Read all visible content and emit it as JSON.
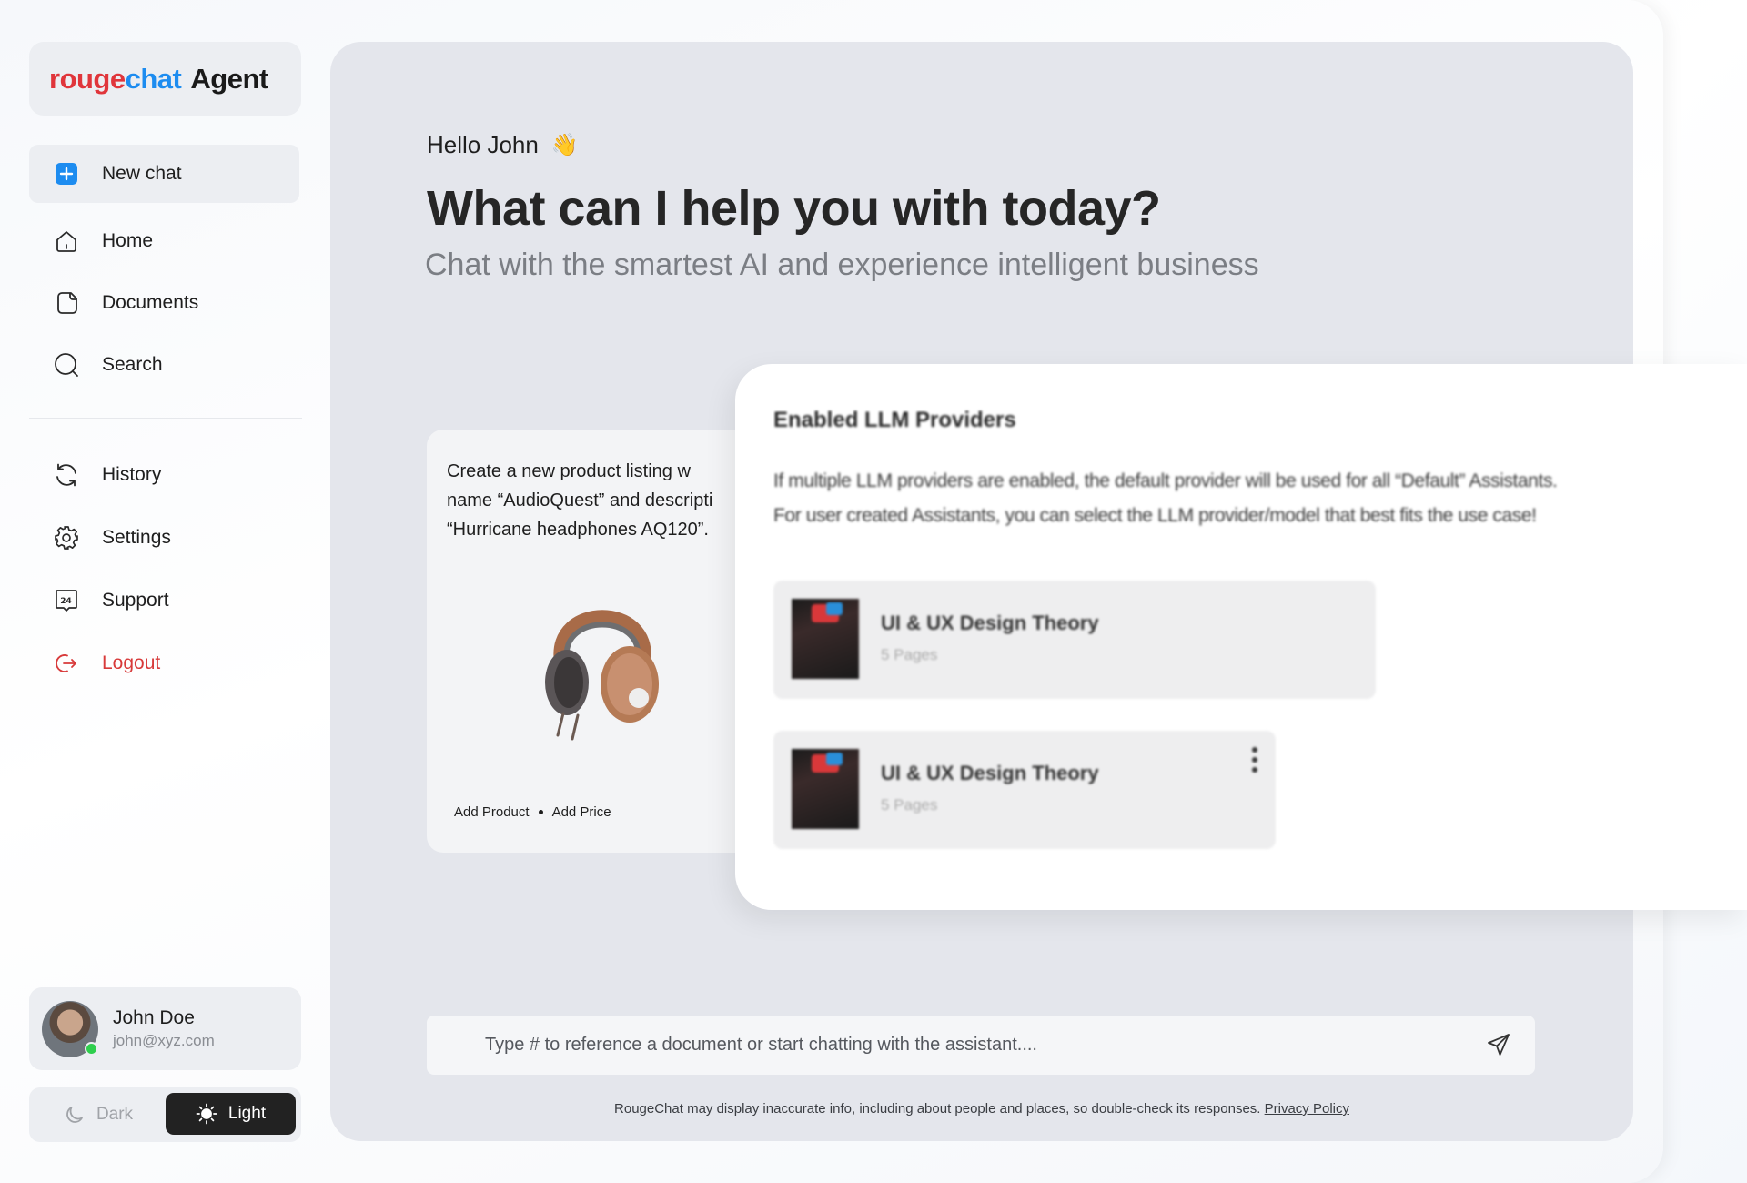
{
  "brand": {
    "rouge": "rouge",
    "chat": "chat",
    "agent": "Agent",
    "colors": {
      "rouge": "#e0353b",
      "chat": "#1d8cf0"
    }
  },
  "sidebar": {
    "items": [
      {
        "label": "New chat",
        "icon": "plus-square-icon"
      },
      {
        "label": "Home",
        "icon": "home-icon"
      },
      {
        "label": "Documents",
        "icon": "document-icon"
      },
      {
        "label": "Search",
        "icon": "search-icon"
      },
      {
        "label": "History",
        "icon": "refresh-icon"
      },
      {
        "label": "Settings",
        "icon": "gear-icon"
      },
      {
        "label": "Support",
        "icon": "support-24-icon"
      },
      {
        "label": "Logout",
        "icon": "logout-icon"
      }
    ]
  },
  "profile": {
    "name": "John Doe",
    "email": "john@xyz.com",
    "status": "online"
  },
  "theme": {
    "dark_label": "Dark",
    "light_label": "Light",
    "selected": "Light"
  },
  "main": {
    "greeting": "Hello John",
    "wave": "👋",
    "headline": "What  can I help you with today?",
    "subhead": "Chat with the smartest AI and experience intelligent business"
  },
  "prompt_card": {
    "line1": "Create a new product listing w",
    "line2": "name “AudioQuest” and descripti",
    "line3": "“Hurricane headphones AQ120”.",
    "action1": "Add Product",
    "action2": "Add Price"
  },
  "llm_panel": {
    "title": "Enabled LLM Providers",
    "desc_line1": "If multiple LLM providers are enabled, the default provider will be used for all “Default” Assistants.",
    "desc_line2": "For user created Assistants, you can select the LLM provider/model that best fits the use case!",
    "docs": [
      {
        "title": "UI & UX Design Theory",
        "sub": "5 Pages"
      },
      {
        "title": "UI & UX Design Theory",
        "sub": "5 Pages"
      }
    ]
  },
  "chat_input": {
    "placeholder": "Type # to reference a document or start chatting with the assistant...."
  },
  "disclaimer": {
    "text": "RougeChat may display inaccurate info, including about people and places, so double-check its responses. ",
    "link": "Privacy Policy"
  }
}
